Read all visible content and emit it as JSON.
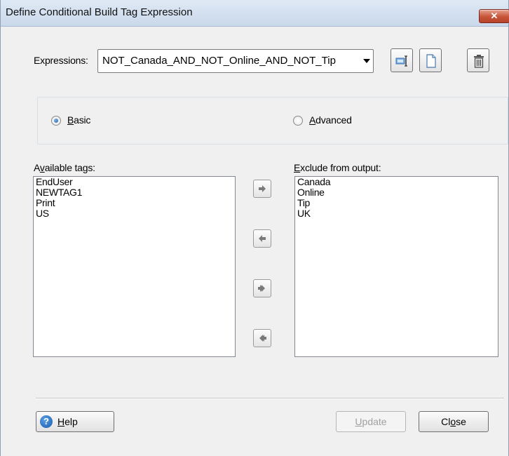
{
  "window": {
    "title": "Define Conditional Build Tag Expression",
    "close_glyph": "✕"
  },
  "expressions": {
    "label_pre": "Expressions:",
    "selected_value": "NOT_Canada_AND_NOT_Online_AND_NOT_Tip"
  },
  "toolbar": {
    "icons": [
      "rename-icon",
      "new-document-icon",
      "trash-icon"
    ]
  },
  "mode": {
    "basic_accel": "B",
    "basic_rest": "asic",
    "advanced_accel": "A",
    "advanced_rest": "dvanced",
    "selected": "basic"
  },
  "available": {
    "label_pre": "A",
    "label_accel": "v",
    "label_rest": "ailable tags:",
    "items": [
      "EndUser",
      "NEWTAG1",
      "Print",
      "US"
    ]
  },
  "excluded": {
    "label_pre": "",
    "label_accel": "E",
    "label_rest": "xclude from output:",
    "items": [
      "Canada",
      "Online",
      "Tip",
      "UK"
    ]
  },
  "transfer_buttons": [
    "arrow-right-icon",
    "arrow-left-icon",
    "double-arrow-right-icon",
    "double-arrow-left-icon"
  ],
  "buttons": {
    "help_glyph": "?",
    "help_accel": "H",
    "help_rest": "elp",
    "update_accel": "U",
    "update_rest": "pdate",
    "close_pre": "Cl",
    "close_accel": "o",
    "close_rest": "se"
  },
  "colors": {
    "title_bar": "#c9d8eb",
    "close_button": "#c75438",
    "radio_dot": "#1d5fa8",
    "dialog_bg": "#f0f0f0"
  }
}
